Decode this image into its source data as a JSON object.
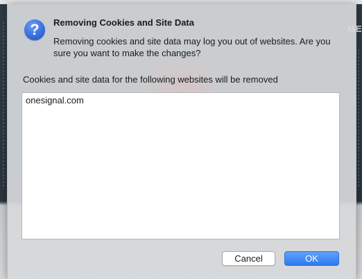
{
  "background": {
    "edge_text": "ME"
  },
  "dialog": {
    "icon": "question-mark-icon",
    "icon_glyph": "?",
    "title": "Removing Cookies and Site Data",
    "message": "Removing cookies and site data may log you out of websites. Are you sure you want to make the changes?",
    "list_caption": "Cookies and site data for the following websites will be removed",
    "sites": [
      "onesignal.com"
    ],
    "cancel_label": "Cancel",
    "ok_label": "OK",
    "accent_color": "#2b7af0"
  }
}
